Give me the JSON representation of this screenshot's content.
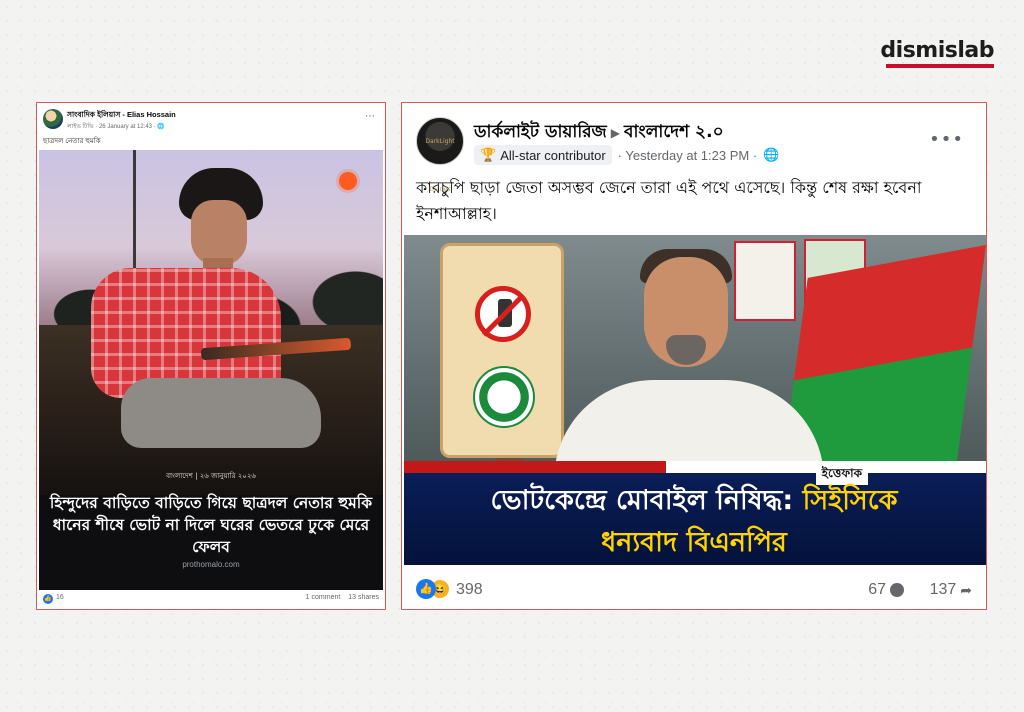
{
  "brand": {
    "name": "dismislab",
    "accent_color": "#c8102e"
  },
  "left_post": {
    "author": "সাংবাদিক ইলিয়াস - Elias Hossain",
    "meta": "লাইভ টিভি · 26 January at 12:43 · 🌐",
    "caption": "ছাত্রদল নেতার হুমকি",
    "image": {
      "date_line": "বাংলাদেশ | ২৬ জানুয়ারি ২০২৬",
      "headline": "হিন্দুদের বাড়িতে বাড়িতে গিয়ে ছাত্রদল নেতার হুমকি ধানের শীষে ভোট না দিলে ঘরের ভেতরে ঢুকে মেরে ফেলব",
      "source": "prothomalo.com"
    },
    "likes": "16",
    "comments": "1 comment",
    "shares": "13 shares",
    "more_icon": "⋯"
  },
  "right_post": {
    "page_name": "ডার্কলাইট ডায়ারিজ",
    "group_name": "বাংলাদেশ ২.০",
    "avatar_text": "DarkLight Diaries",
    "badge": "All-star contributor",
    "time": "Yesterday at 1:23 PM",
    "privacy_icon": "globe-icon",
    "text": "কারচুপি ছাড়া জেতা অসম্ভব জেনে তারা এই পথে এসেছে। কিন্তু শেষ রক্ষা হবেনা ইনশাআল্লাহ।",
    "image": {
      "logo": "ইত্তেফাক",
      "headline_part1": "ভোটকেন্দ্রে মোবাইল নিষিদ্ধ: ",
      "headline_highlight": "সিইসিকে",
      "headline_line2": "ধন্যবাদ বিএনপির"
    },
    "reactions": "398",
    "comments": "67",
    "shares": "137",
    "more_icon": "•••"
  }
}
